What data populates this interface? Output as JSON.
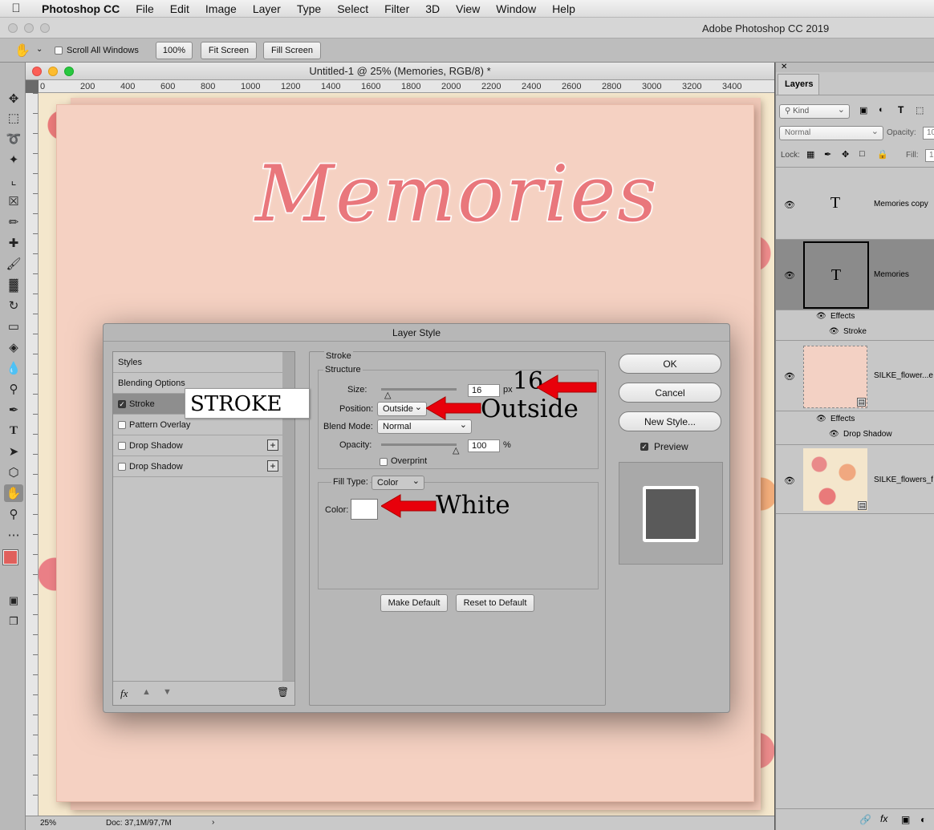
{
  "menubar": {
    "app": "Photoshop CC",
    "items": [
      "File",
      "Edit",
      "Image",
      "Layer",
      "Type",
      "Select",
      "Filter",
      "3D",
      "View",
      "Window",
      "Help"
    ]
  },
  "window_title": "Adobe Photoshop CC 2019",
  "options": {
    "scroll_all": "Scroll All Windows",
    "zoom100": "100%",
    "fit_screen": "Fit Screen",
    "fill_screen": "Fill Screen"
  },
  "document": {
    "title": "Untitled-1 @ 25% (Memories, RGB/8) *",
    "ruler_ticks": [
      "0",
      "200",
      "400",
      "600",
      "800",
      "1000",
      "1200",
      "1400",
      "1600",
      "1800",
      "2000",
      "2200",
      "2400",
      "2600",
      "2800",
      "3000",
      "3200",
      "3400"
    ],
    "artwork_text": "Memories",
    "status_zoom": "25%",
    "status_doc": "Doc: 37,1M/97,7M"
  },
  "dialog": {
    "title": "Layer Style",
    "left_items": [
      {
        "label": "Styles",
        "checkbox": false
      },
      {
        "label": "Blending Options",
        "checkbox": false
      },
      {
        "label": "Stroke",
        "checkbox": true,
        "checked": true,
        "selected": true
      },
      {
        "label": "Pattern Overlay",
        "checkbox": true,
        "checked": false
      },
      {
        "label": "Drop Shadow",
        "checkbox": true,
        "checked": false,
        "plus": true
      },
      {
        "label": "Drop Shadow",
        "checkbox": true,
        "checked": false,
        "plus": true
      }
    ],
    "section_title": "Stroke",
    "structure_title": "Structure",
    "size_label": "Size:",
    "size_value": "16",
    "size_unit": "px",
    "position_label": "Position:",
    "position_value": "Outside",
    "blend_label": "Blend Mode:",
    "blend_value": "Normal",
    "opacity_label": "Opacity:",
    "opacity_value": "100",
    "opacity_unit": "%",
    "overprint": "Overprint",
    "fill_type_label": "Fill Type:",
    "fill_type_value": "Color",
    "color_label": "Color:",
    "make_default": "Make Default",
    "reset_default": "Reset to Default",
    "ok": "OK",
    "cancel": "Cancel",
    "new_style": "New Style...",
    "preview": "Preview",
    "fx": "fx"
  },
  "annotations": {
    "stroke": "STROKE",
    "size": "16",
    "position": "Outside",
    "color": "White"
  },
  "layers_panel": {
    "tab": "Layers",
    "kind": "Kind",
    "blend": "Normal",
    "opacity_label": "Opacity:",
    "opacity_value": "10",
    "lock_label": "Lock:",
    "fill_label": "Fill:",
    "fill_value": "1",
    "layers": [
      {
        "name": "Memories copy",
        "thumb": "T"
      },
      {
        "name": "Memories",
        "thumb": "T",
        "effects": "Effects",
        "effect_items": [
          "Stroke"
        ]
      },
      {
        "name": "SILKE_flower...e",
        "effects": "Effects",
        "effect_items": [
          "Drop Shadow"
        ]
      },
      {
        "name": "SILKE_flowers_f"
      }
    ]
  },
  "colors": {
    "accent_red": "#e8000b",
    "stroke_white": "#ffffff",
    "text_pink": "#e9777c",
    "foreground": "#e0605c"
  }
}
